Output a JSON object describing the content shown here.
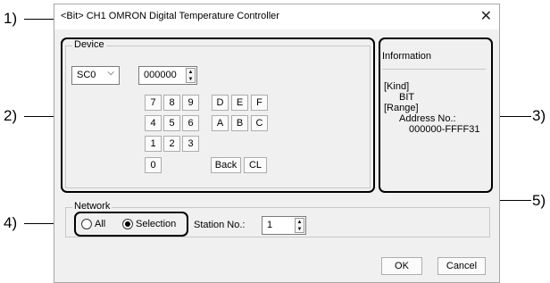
{
  "callouts": {
    "c1": "1)",
    "c2": "2)",
    "c3": "3)",
    "c4": "4)",
    "c5": "5)"
  },
  "dialog": {
    "title": "<Bit> CH1 OMRON Digital Temperature Controller",
    "close_icon": "close-icon"
  },
  "device": {
    "group_label": "Device",
    "device_type": "SC0",
    "address": "000000",
    "keys_row1": [
      "7",
      "8",
      "9",
      "D",
      "E",
      "F"
    ],
    "keys_row2": [
      "4",
      "5",
      "6",
      "A",
      "B",
      "C"
    ],
    "keys_row3": [
      "1",
      "2",
      "3"
    ],
    "key_zero": "0",
    "back_label": "Back",
    "clear_label": "CL"
  },
  "information": {
    "heading": "Information",
    "kind_label": "[Kind]",
    "kind_value": "BIT",
    "range_label": "[Range]",
    "address_label": "Address No.:",
    "address_range": "000000-FFFF31"
  },
  "network": {
    "group_label": "Network",
    "all_label": "All",
    "selection_label": "Selection",
    "selected": "Selection",
    "station_label": "Station No.:",
    "station_value": "1"
  },
  "buttons": {
    "ok": "OK",
    "cancel": "Cancel"
  }
}
